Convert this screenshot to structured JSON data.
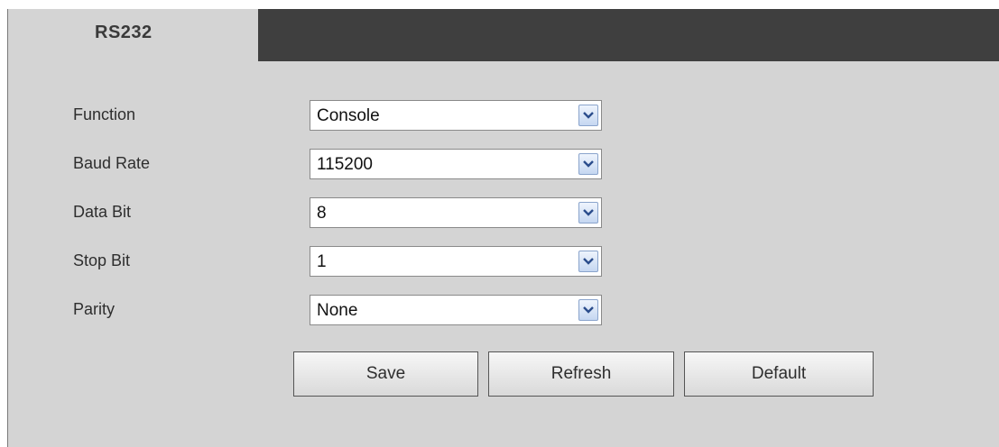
{
  "tab": {
    "label": "RS232"
  },
  "form": {
    "fields": [
      {
        "label": "Function",
        "value": "Console"
      },
      {
        "label": "Baud Rate",
        "value": "115200"
      },
      {
        "label": "Data Bit",
        "value": "8"
      },
      {
        "label": "Stop Bit",
        "value": "1"
      },
      {
        "label": "Parity",
        "value": "None"
      }
    ]
  },
  "buttons": {
    "save_label": "Save",
    "refresh_label": "Refresh",
    "default_label": "Default"
  },
  "colors": {
    "panel_background": "#d4d4d4",
    "header_strip": "#3f3f3f",
    "dropdown_arrow_accent": "#8aa4cc"
  }
}
